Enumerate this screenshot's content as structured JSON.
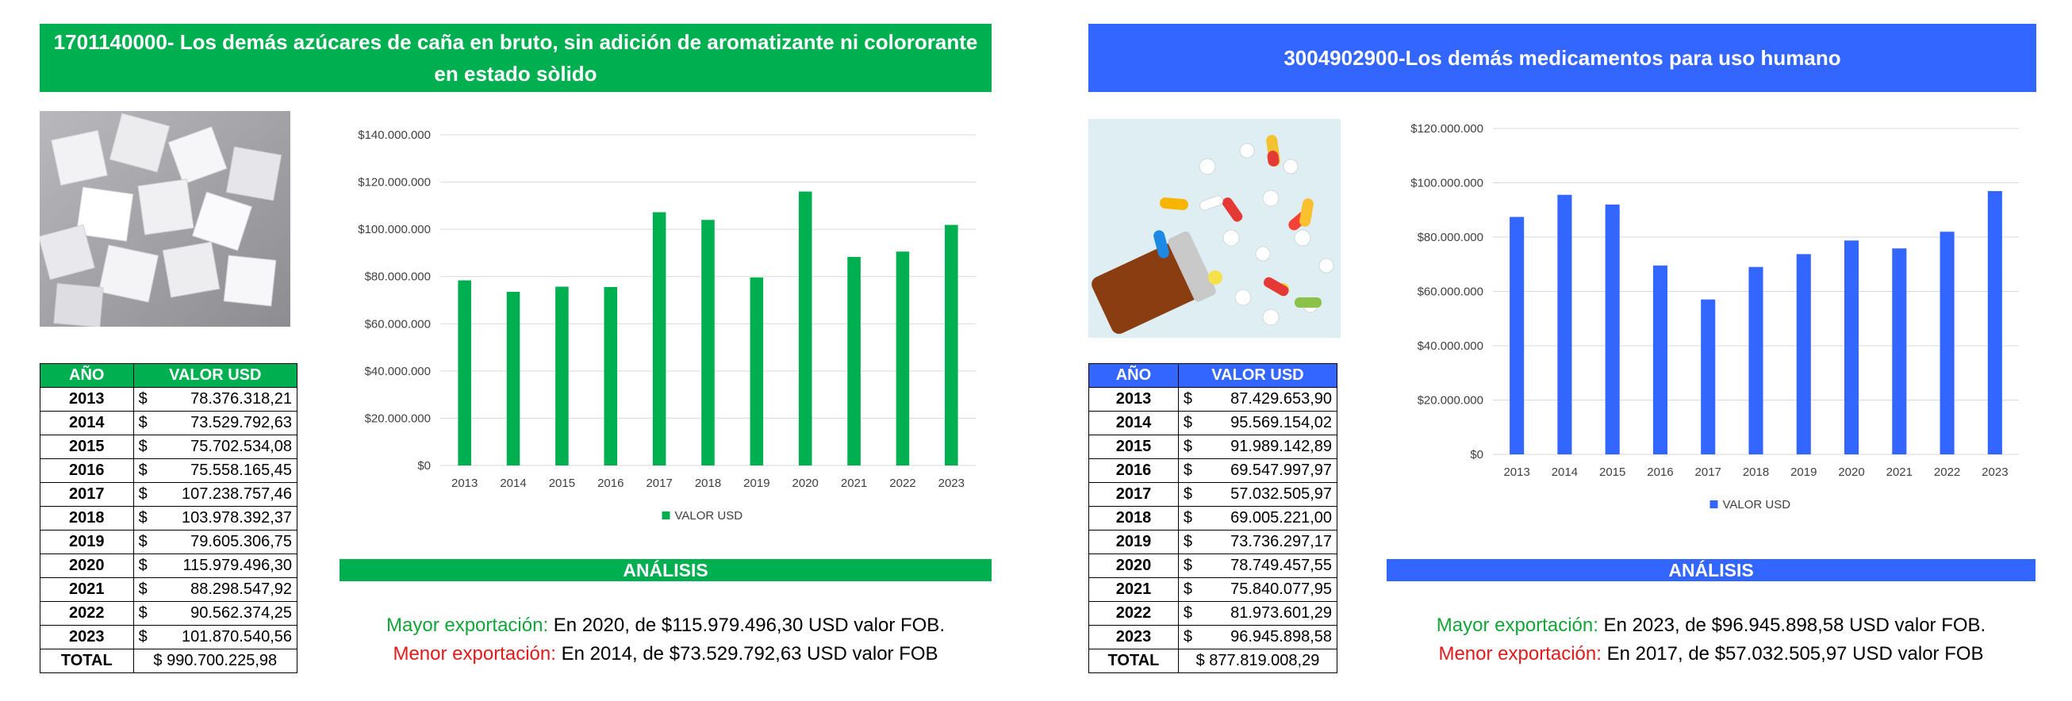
{
  "colors": {
    "green": "#00b050",
    "blue": "#3366ff"
  },
  "panels": [
    {
      "title": "1701140000- Los demás azúcares de caña en bruto, sin adición de aromatizante ni colororante en estado sòlido",
      "table": {
        "header_year": "AÑO",
        "header_value": "VALOR USD",
        "rows": [
          {
            "year": "2013",
            "currency": "$",
            "value": "78.376.318,21"
          },
          {
            "year": "2014",
            "currency": "$",
            "value": "73.529.792,63"
          },
          {
            "year": "2015",
            "currency": "$",
            "value": "75.702.534,08"
          },
          {
            "year": "2016",
            "currency": "$",
            "value": "75.558.165,45"
          },
          {
            "year": "2017",
            "currency": "$",
            "value": "107.238.757,46"
          },
          {
            "year": "2018",
            "currency": "$",
            "value": "103.978.392,37"
          },
          {
            "year": "2019",
            "currency": "$",
            "value": "79.605.306,75"
          },
          {
            "year": "2020",
            "currency": "$",
            "value": "115.979.496,30"
          },
          {
            "year": "2021",
            "currency": "$",
            "value": "88.298.547,92"
          },
          {
            "year": "2022",
            "currency": "$",
            "value": "90.562.374,25"
          },
          {
            "year": "2023",
            "currency": "$",
            "value": "101.870.540,56"
          }
        ],
        "total_label": "TOTAL",
        "total_value": "$ 990.700.225,98"
      },
      "analysis": {
        "heading": "ANÁLISIS",
        "max_label": "Mayor exportación:",
        "max_text": " En 2020, de $115.979.496,30 USD valor FOB.",
        "min_label": "Menor exportación:",
        "min_text": " En 2014, de $73.529.792,63 USD valor FOB"
      }
    },
    {
      "title": "3004902900-Los demás medicamentos para uso humano",
      "table": {
        "header_year": "AÑO",
        "header_value": "VALOR USD",
        "rows": [
          {
            "year": "2013",
            "currency": "$",
            "value": "87.429.653,90"
          },
          {
            "year": "2014",
            "currency": "$",
            "value": "95.569.154,02"
          },
          {
            "year": "2015",
            "currency": "$",
            "value": "91.989.142,89"
          },
          {
            "year": "2016",
            "currency": "$",
            "value": "69.547.997,97"
          },
          {
            "year": "2017",
            "currency": "$",
            "value": "57.032.505,97"
          },
          {
            "year": "2018",
            "currency": "$",
            "value": "69.005.221,00"
          },
          {
            "year": "2019",
            "currency": "$",
            "value": "73.736.297,17"
          },
          {
            "year": "2020",
            "currency": "$",
            "value": "78.749.457,55"
          },
          {
            "year": "2021",
            "currency": "$",
            "value": "75.840.077,95"
          },
          {
            "year": "2022",
            "currency": "$",
            "value": "81.973.601,29"
          },
          {
            "year": "2023",
            "currency": "$",
            "value": "96.945.898,58"
          }
        ],
        "total_label": "TOTAL",
        "total_value": "$ 877.819.008,29"
      },
      "analysis": {
        "heading": "ANÁLISIS",
        "max_label": "Mayor exportación:",
        "max_text": " En 2023, de $96.945.898,58 USD valor FOB.",
        "min_label": "Menor exportación:",
        "min_text": " En 2017, de $57.032.505,97 USD valor FOB"
      }
    }
  ],
  "chart_data": [
    {
      "type": "bar",
      "categories": [
        "2013",
        "2014",
        "2015",
        "2016",
        "2017",
        "2018",
        "2019",
        "2020",
        "2021",
        "2022",
        "2023"
      ],
      "series": [
        {
          "name": "VALOR USD",
          "values": [
            78376318.21,
            73529792.63,
            75702534.08,
            75558165.45,
            107238757.46,
            103978392.37,
            79605306.75,
            115979496.3,
            88298547.92,
            90562374.25,
            101870540.56
          ]
        }
      ],
      "ylim": [
        0,
        140000000
      ],
      "yticks": [
        "$0",
        "$20.000.000",
        "$40.000.000",
        "$60.000.000",
        "$80.000.000",
        "$100.000.000",
        "$120.000.000",
        "$140.000.000"
      ],
      "grid": true,
      "legend": "bottom",
      "color": "#00b050"
    },
    {
      "type": "bar",
      "categories": [
        "2013",
        "2014",
        "2015",
        "2016",
        "2017",
        "2018",
        "2019",
        "2020",
        "2021",
        "2022",
        "2023"
      ],
      "series": [
        {
          "name": "VALOR USD",
          "values": [
            87429653.9,
            95569154.02,
            91989142.89,
            69547997.97,
            57032505.97,
            69005221.0,
            73736297.17,
            78749457.55,
            75840077.95,
            81973601.29,
            96945898.58
          ]
        }
      ],
      "ylim": [
        0,
        120000000
      ],
      "yticks": [
        "$0",
        "$20.000.000",
        "$40.000.000",
        "$60.000.000",
        "$80.000.000",
        "$100.000.000",
        "$120.000.000"
      ],
      "grid": true,
      "legend": "bottom",
      "color": "#3366ff"
    }
  ]
}
